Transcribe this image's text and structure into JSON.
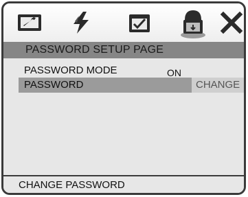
{
  "toolbar": {
    "icons": [
      "system-setup-icon",
      "audio-setup-icon",
      "preference-setup-icon",
      "password-lock-icon",
      "exit-icon"
    ],
    "selected": "password-lock-icon"
  },
  "page": {
    "title": "PASSWORD SETUP PAGE"
  },
  "menu": {
    "items": [
      {
        "label": "PASSWORD MODE",
        "value": "ON"
      },
      {
        "label": "PASSWORD",
        "value": "CHANGE"
      }
    ],
    "selected_index": 1
  },
  "status": {
    "hint": "CHANGE PASSWORD"
  },
  "colors": {
    "title_bar": "#868686",
    "highlight_row": "#9b9b9b",
    "background": "#e7e7e7",
    "border": "#3a3a3a"
  }
}
